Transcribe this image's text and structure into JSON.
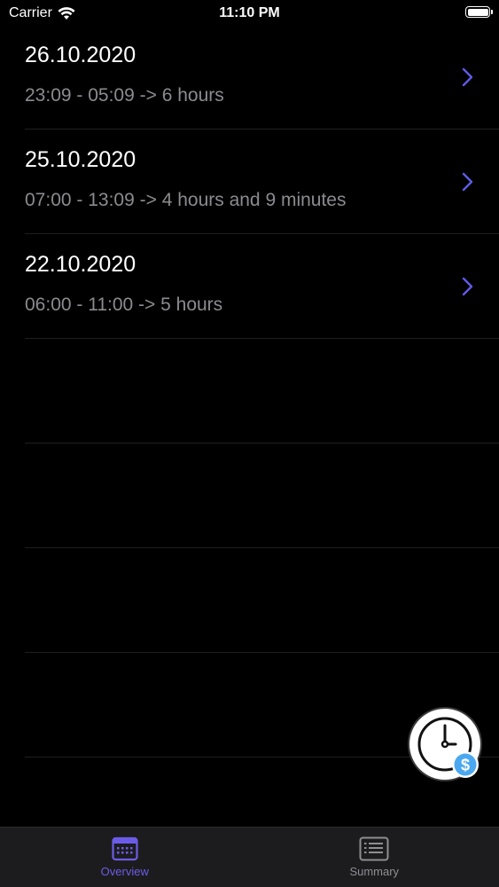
{
  "status_bar": {
    "carrier": "Carrier",
    "time": "11:10 PM",
    "battery_level": 1.0
  },
  "entries": [
    {
      "date": "26.10.2020",
      "summary": "23:09 - 05:09 -> 6 hours"
    },
    {
      "date": "25.10.2020",
      "summary": "07:00 - 13:09 -> 4 hours and 9 minutes"
    },
    {
      "date": "22.10.2020",
      "summary": "06:00 - 11:00 -> 5 hours"
    }
  ],
  "fab": {
    "icon": "clock-dollar-icon"
  },
  "tab_bar": {
    "tabs": [
      {
        "label": "Overview",
        "icon": "calendar-icon",
        "active": true
      },
      {
        "label": "Summary",
        "icon": "list-document-icon",
        "active": false
      }
    ]
  },
  "colors": {
    "accent": "#6b5ce7",
    "chevron": "#5e5ce6",
    "subtitle": "#8b8b90",
    "background": "#000000",
    "tab_bar": "#1c1c1e",
    "fab_badge": "#4aa8f0"
  }
}
